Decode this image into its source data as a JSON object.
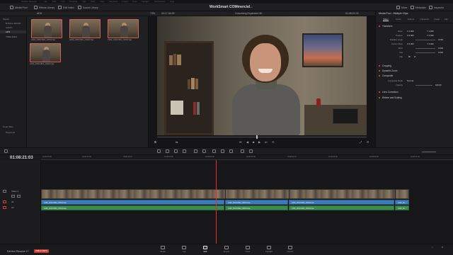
{
  "menubar": [
    "DaVinci Resolve",
    "File",
    "Edit",
    "Trim",
    "Timeline",
    "Clip",
    "Mark",
    "View",
    "Playback",
    "Fusion",
    "Color",
    "Fairlight",
    "Workspace",
    "Help"
  ],
  "toolbar": {
    "media_pool": "Media Pool",
    "effects_library": "Effects Library",
    "edit_index": "Edit Index",
    "sound_library": "Sound Library",
    "project_title": "WorkSmart COMmercial",
    "edited": "Edited",
    "mixer": "Mixer",
    "metadata": "Metadata",
    "inspector": "Inspector"
  },
  "viewer_head": {
    "bin": "ADS",
    "zoom": "73%",
    "source_tc": "00:17:34:09",
    "timeline_name": "Coworking Expanded 4K",
    "record_tc": "01:08:21:03"
  },
  "sidebar": {
    "master": "Master",
    "items": [
      "B-ROLL-ROOM",
      "AUDIO",
      "ADS",
      "TIMELINES"
    ],
    "active": 2,
    "smart_bins": "Smart Bins",
    "keywords": "Keywords"
  },
  "media_pool": {
    "clips": [
      "A103_C004 0921_C001.braw",
      "A103_C004 0921_C002.braw",
      "A103_C004 0921_C003.braw",
      "A103_C004 0921_C004.braw"
    ]
  },
  "inspector": {
    "title": "Media Pool - Multiple Clips",
    "tabs": [
      "Video",
      "Audio",
      "Effects",
      "Transition",
      "Image",
      "File"
    ],
    "transform": "Transform",
    "zoom_label": "Zoom",
    "zoom_x": "X  1.000",
    "zoom_y": "Y  1.000",
    "position_label": "Position",
    "pos_x": "X  0.000",
    "pos_y": "Y  0.000",
    "rotation_label": "Rotation Angle",
    "rotation_val": "0.000",
    "anchor_label": "Anchor Point",
    "anchor_x": "X  0.000",
    "anchor_y": "Y  0.000",
    "pitch_label": "Pitch",
    "pitch_val": "0.000",
    "yaw_label": "Yaw",
    "yaw_val": "0.000",
    "flip_label": "Flip",
    "cropping": "Cropping",
    "dynamic_zoom": "Dynamic Zoom",
    "composite": "Composite",
    "comp_mode_label": "Composite Mode",
    "comp_mode_val": "Normal",
    "opacity_label": "Opacity",
    "opacity_val": "100.00",
    "lens_correction": "Lens Correction",
    "retime_scaling": "Retime and Scaling"
  },
  "timeline": {
    "timecode": "01:08:21:03",
    "ruler": [
      "01:08:08:00",
      "01:08:12:00",
      "01:08:16:00",
      "01:08:20:00",
      "01:08:24:00",
      "01:08:28:00",
      "01:08:32:00",
      "01:08:36:00",
      "01:08:40:00",
      "01:08:44:00"
    ],
    "video_track": "Video 1",
    "audio_track_1": "A1",
    "audio_track_2": "A2",
    "audio_clips_1": [
      "A103_C004 0921_C001.braw",
      "A103_C004 0921_C002.braw",
      "A103_C004 0921_C003.braw",
      "A103_C0..."
    ],
    "audio_clips_2": [
      "A103_C004 0921_C001.braw",
      "A103_C004 0921_C002.braw",
      "A103_C004 0921_C003.braw",
      "A103_C0..."
    ]
  },
  "pages": [
    "Media",
    "Cut",
    "Edit",
    "Fusion",
    "Color",
    "Fairlight",
    "Deliver"
  ],
  "active_page": 2,
  "app": {
    "name": "DaVinci Resolve 17",
    "badge": "PUBLIC BETA"
  },
  "colors": {
    "accent_red": "#e03030",
    "audio_blue": "#3b7bb8",
    "audio_green": "#3b8a4e",
    "clip_border": "#c96450"
  }
}
